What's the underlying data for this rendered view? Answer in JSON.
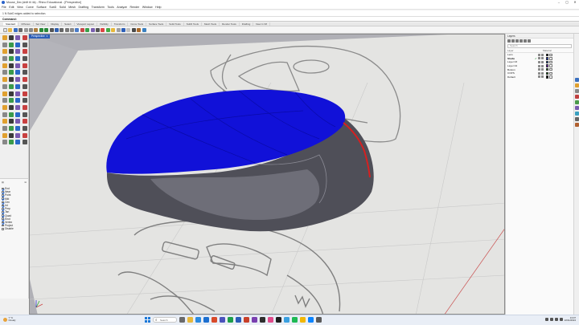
{
  "window": {
    "title": "Mouse_Der.(shift til 4k) - Rhino Educational - [Perspective]",
    "controls": [
      "–",
      "▢",
      "✕"
    ]
  },
  "menu": [
    "File",
    "Edit",
    "View",
    "Curve",
    "Surface",
    "SubD",
    "Solid",
    "Mesh",
    "Drafting",
    "Transform",
    "Tools",
    "Analyze",
    "Render",
    "Window",
    "Help"
  ],
  "command_history": "1 N SubD edges added to selection.",
  "command_prompt": "Command:",
  "toolbar_tabs": [
    "Standard",
    "CPlanes",
    "Set View",
    "Display",
    "Select",
    "Viewport Layout",
    "Visibility",
    "Transform",
    "Curve Tools",
    "Surface Tools",
    "Solid Tools",
    "SubD Tools",
    "Mesh Tools",
    "Render Tools",
    "Drafting",
    "New in V8"
  ],
  "viewport": {
    "label": "Perspective"
  },
  "osnap": {
    "items": [
      {
        "label": "End",
        "on": true
      },
      {
        "label": "Near",
        "on": true
      },
      {
        "label": "Point",
        "on": true
      },
      {
        "label": "Mid",
        "on": true
      },
      {
        "label": "Cen",
        "on": true
      },
      {
        "label": "Int",
        "on": true
      },
      {
        "label": "Perp",
        "on": true
      },
      {
        "label": "Tan",
        "on": true
      },
      {
        "label": "Quad",
        "on": true
      },
      {
        "label": "Knot",
        "on": true
      },
      {
        "label": "Vertex",
        "on": true
      },
      {
        "label": "Project",
        "on": false
      },
      {
        "label": "Disable",
        "on": false
      }
    ]
  },
  "layers_panel": {
    "title": "Layers",
    "search_placeholder": "Search",
    "columns": [
      "Layer",
      "Material"
    ],
    "rows": [
      {
        "name": "Lens",
        "color": "#000000",
        "current": false
      },
      {
        "name": "Shelle",
        "color": "#1f3fd6",
        "current": true
      },
      {
        "name": "Layer 03",
        "color": "#1f6fd6",
        "current": false
      },
      {
        "name": "Layer 04",
        "color": "#7a22c8",
        "current": false
      },
      {
        "name": "Bottom",
        "color": "#2d8a2d",
        "current": false
      },
      {
        "name": "COPS",
        "color": "#1a8a1a",
        "current": false
      },
      {
        "name": "Default",
        "color": "#000000",
        "current": false
      }
    ]
  },
  "taskbar": {
    "weather_temp": "7 °C",
    "weather_desc": "Cloudy",
    "search_placeholder": "Search",
    "time": "13:07",
    "date": "22/11/2024"
  },
  "colors": {
    "shell_blue": "#1111d8",
    "body_gray": "#4c4c55",
    "seam_red": "#d62020",
    "viewport_bg": "#b0b0b6"
  }
}
